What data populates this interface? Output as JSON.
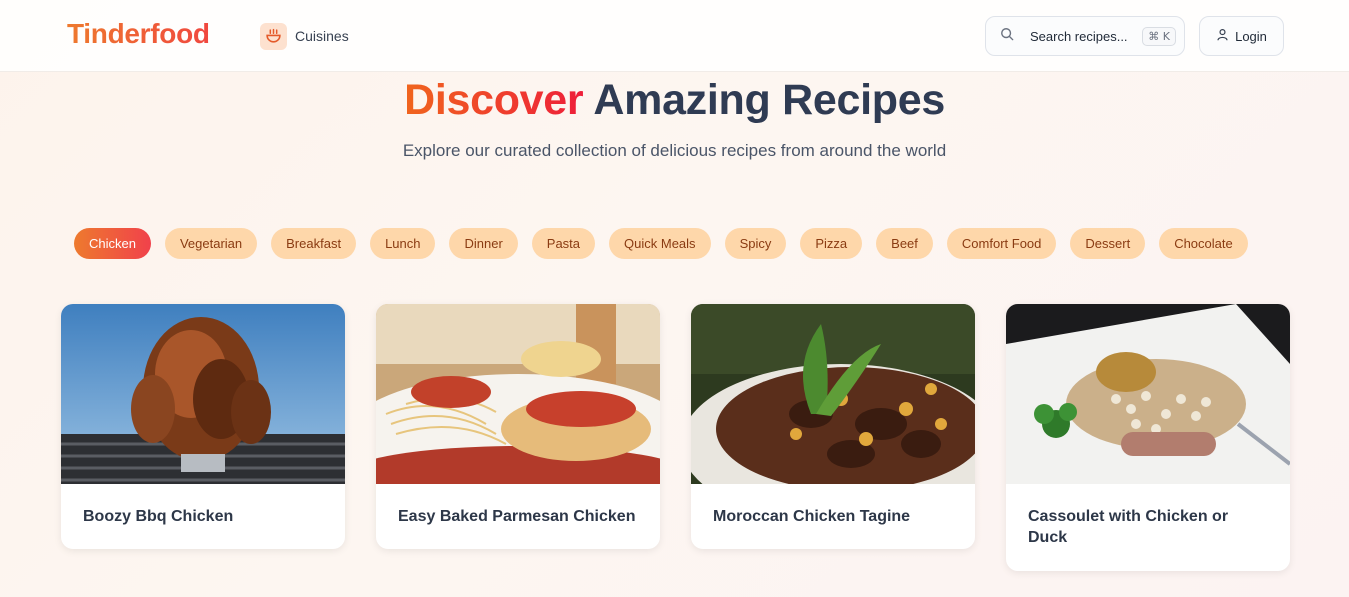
{
  "header": {
    "logo": "Tinderfood",
    "nav": {
      "cuisines_label": "Cuisines",
      "cuisines_icon": "bowl-icon"
    },
    "search": {
      "placeholder": "Search recipes...",
      "shortcut": "⌘ K"
    },
    "login_label": "Login"
  },
  "hero": {
    "title_accent": "Discover",
    "title_rest": " Amazing Recipes",
    "subtitle": "Explore our curated collection of delicious recipes from around the world"
  },
  "categories": {
    "selected": "Chicken",
    "items": [
      "Chicken",
      "Vegetarian",
      "Breakfast",
      "Lunch",
      "Dinner",
      "Pasta",
      "Quick Meals",
      "Spicy",
      "Pizza",
      "Beef",
      "Comfort Food",
      "Dessert",
      "Chocolate"
    ]
  },
  "recipes": [
    {
      "title": "Boozy Bbq Chicken"
    },
    {
      "title": "Easy Baked Parmesan Chicken"
    },
    {
      "title": "Moroccan Chicken Tagine"
    },
    {
      "title": "Cassoulet with Chicken or Duck"
    }
  ],
  "colors": {
    "brand_gradient_start": "#ee7a2e",
    "brand_gradient_end": "#f0473f",
    "chip_bg": "#fed7aa",
    "chip_text": "#8a3b12",
    "heading": "#2f3b53"
  }
}
